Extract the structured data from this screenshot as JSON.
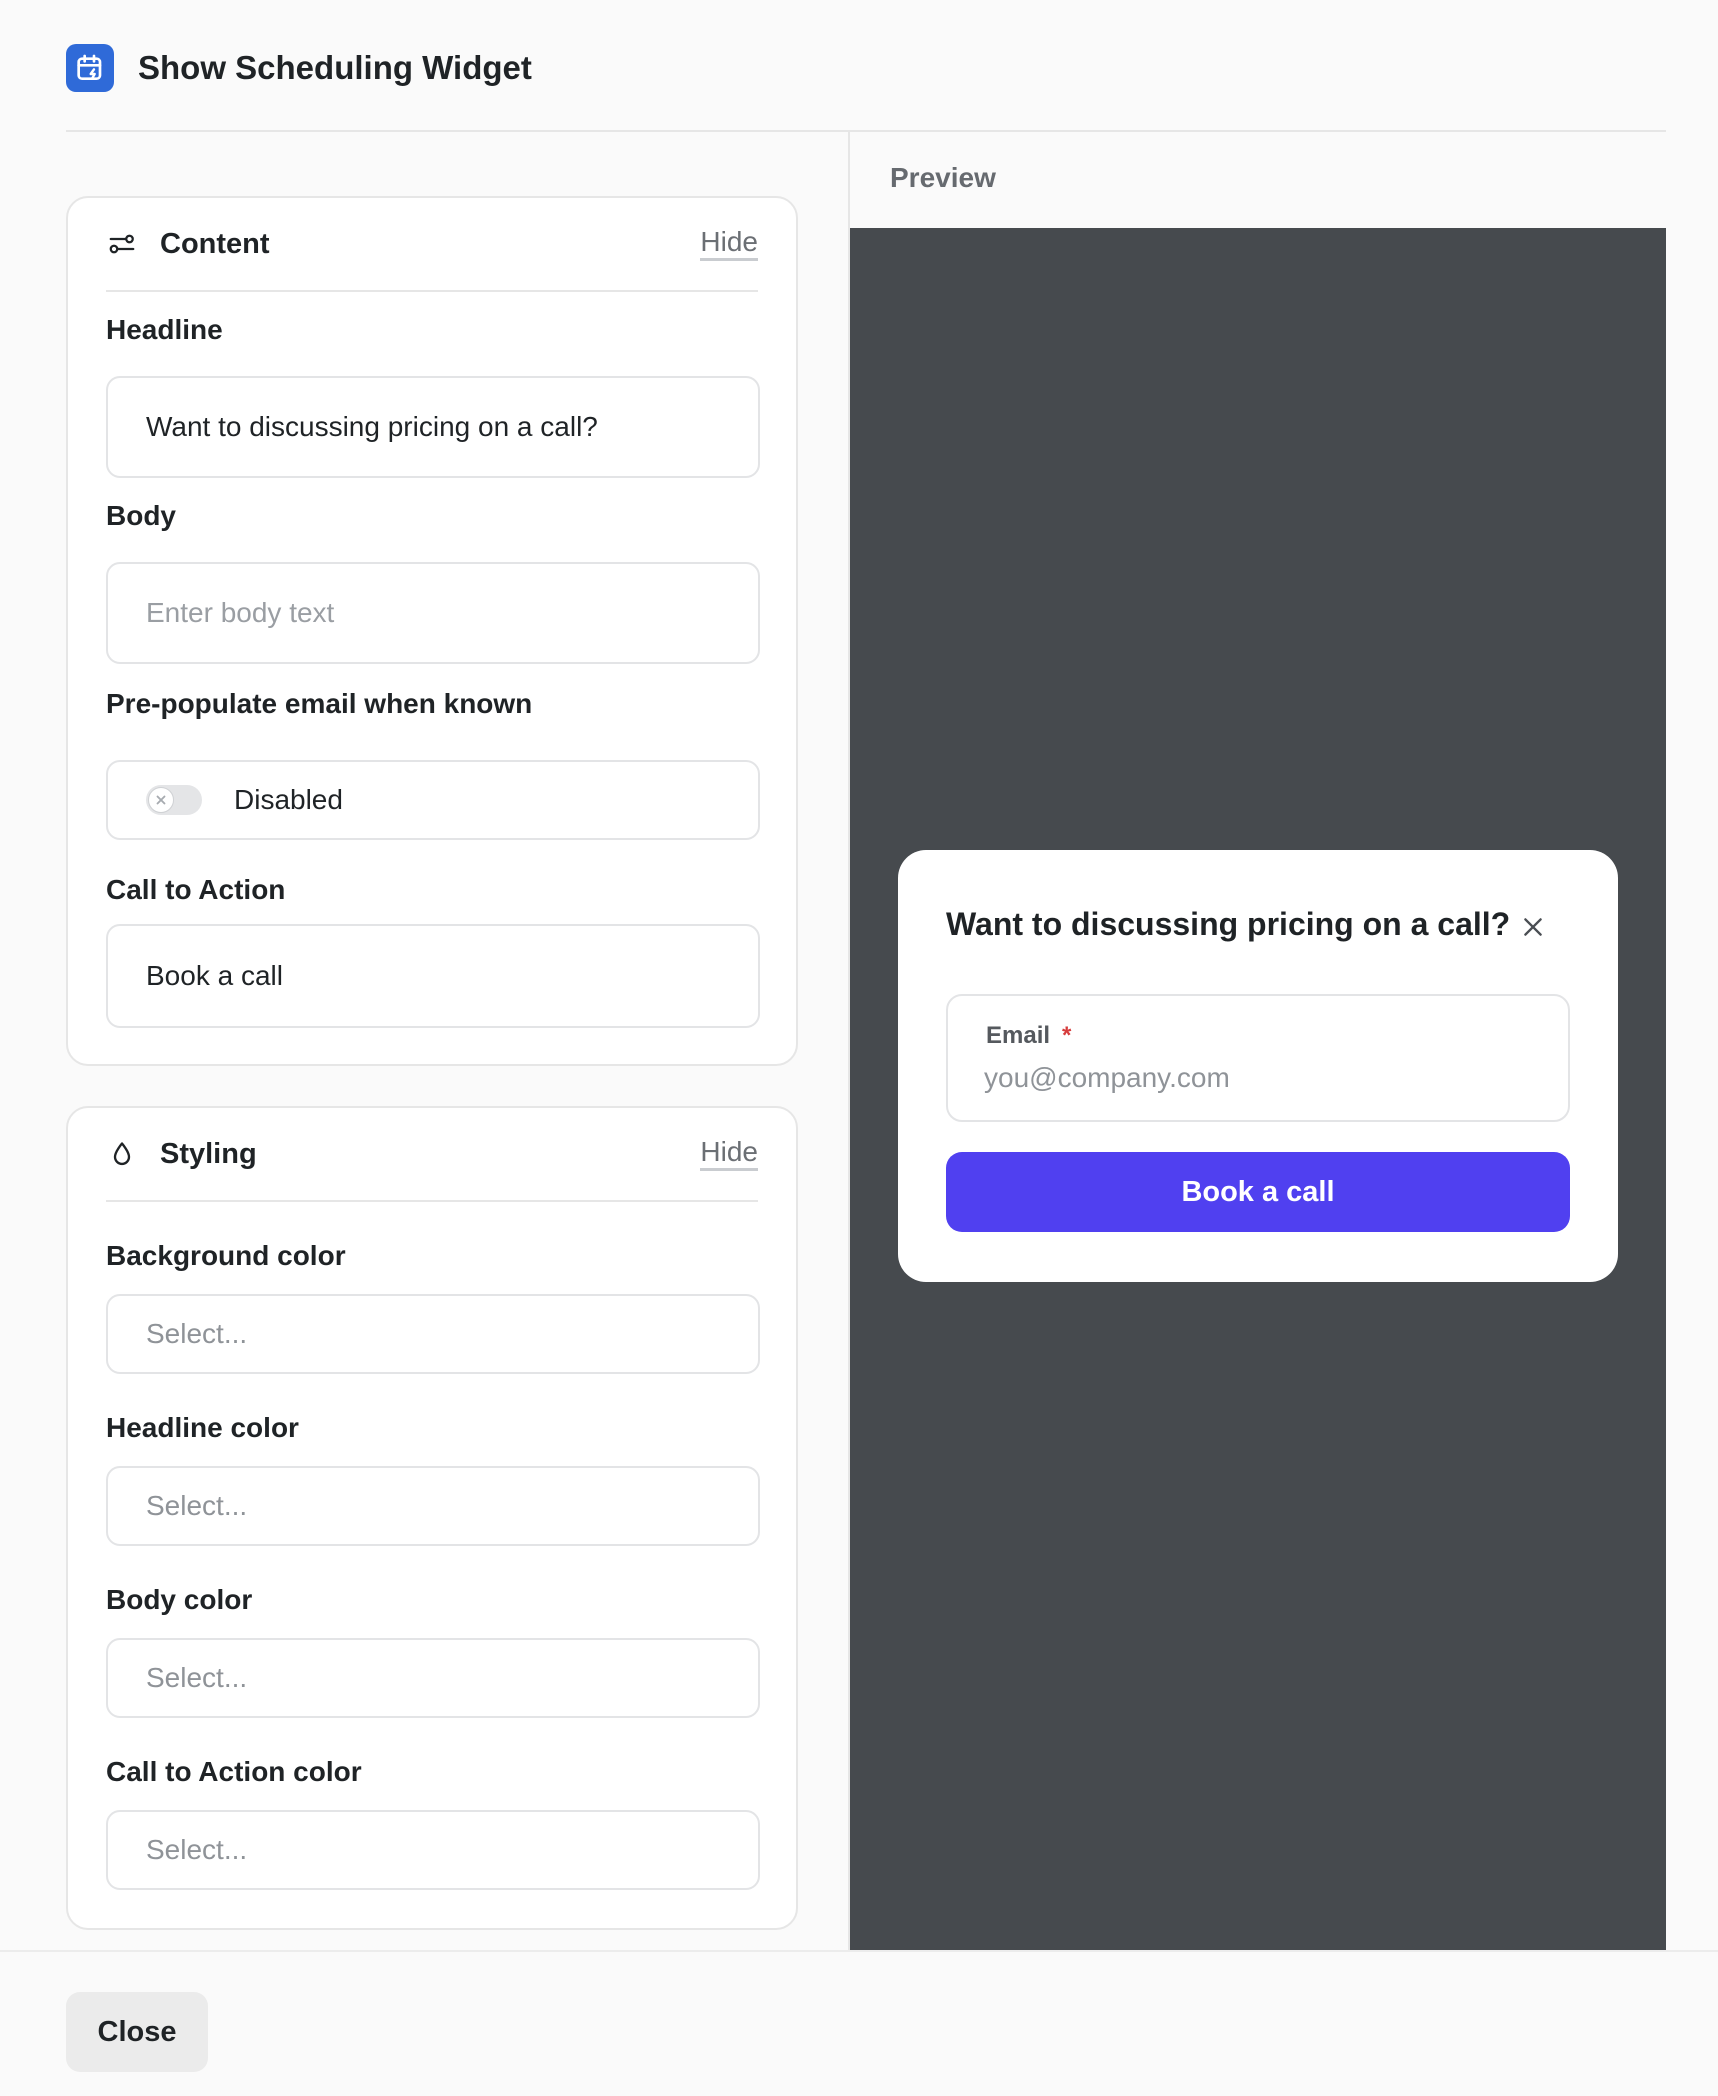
{
  "header": {
    "title": "Show Scheduling Widget",
    "icon": "calendar-bolt-icon",
    "icon_color": "#2f6ad8"
  },
  "content_section": {
    "title": "Content",
    "hide_label": "Hide",
    "icon": "sliders-icon",
    "headline": {
      "label": "Headline",
      "value": "Want to discussing pricing on a call?"
    },
    "body": {
      "label": "Body",
      "value": "",
      "placeholder": "Enter body text"
    },
    "prepopulate_email": {
      "label": "Pre-populate email when known",
      "state_label": "Disabled",
      "enabled": false
    },
    "call_to_action": {
      "label": "Call to Action",
      "value": "Book a call"
    }
  },
  "styling_section": {
    "title": "Styling",
    "hide_label": "Hide",
    "icon": "droplet-icon",
    "background_color": {
      "label": "Background color",
      "placeholder": "Select..."
    },
    "headline_color": {
      "label": "Headline color",
      "placeholder": "Select..."
    },
    "body_color": {
      "label": "Body color",
      "placeholder": "Select..."
    },
    "cta_color": {
      "label": "Call to Action color",
      "placeholder": "Select..."
    }
  },
  "preview": {
    "label": "Preview",
    "background": "#464a4e",
    "modal": {
      "title": "Want to discussing pricing on a call?",
      "email_label": "Email",
      "required_marker": "*",
      "email_placeholder": "you@company.com",
      "button_label": "Book a call",
      "button_color": "#5040f0"
    }
  },
  "footer": {
    "close_label": "Close"
  }
}
